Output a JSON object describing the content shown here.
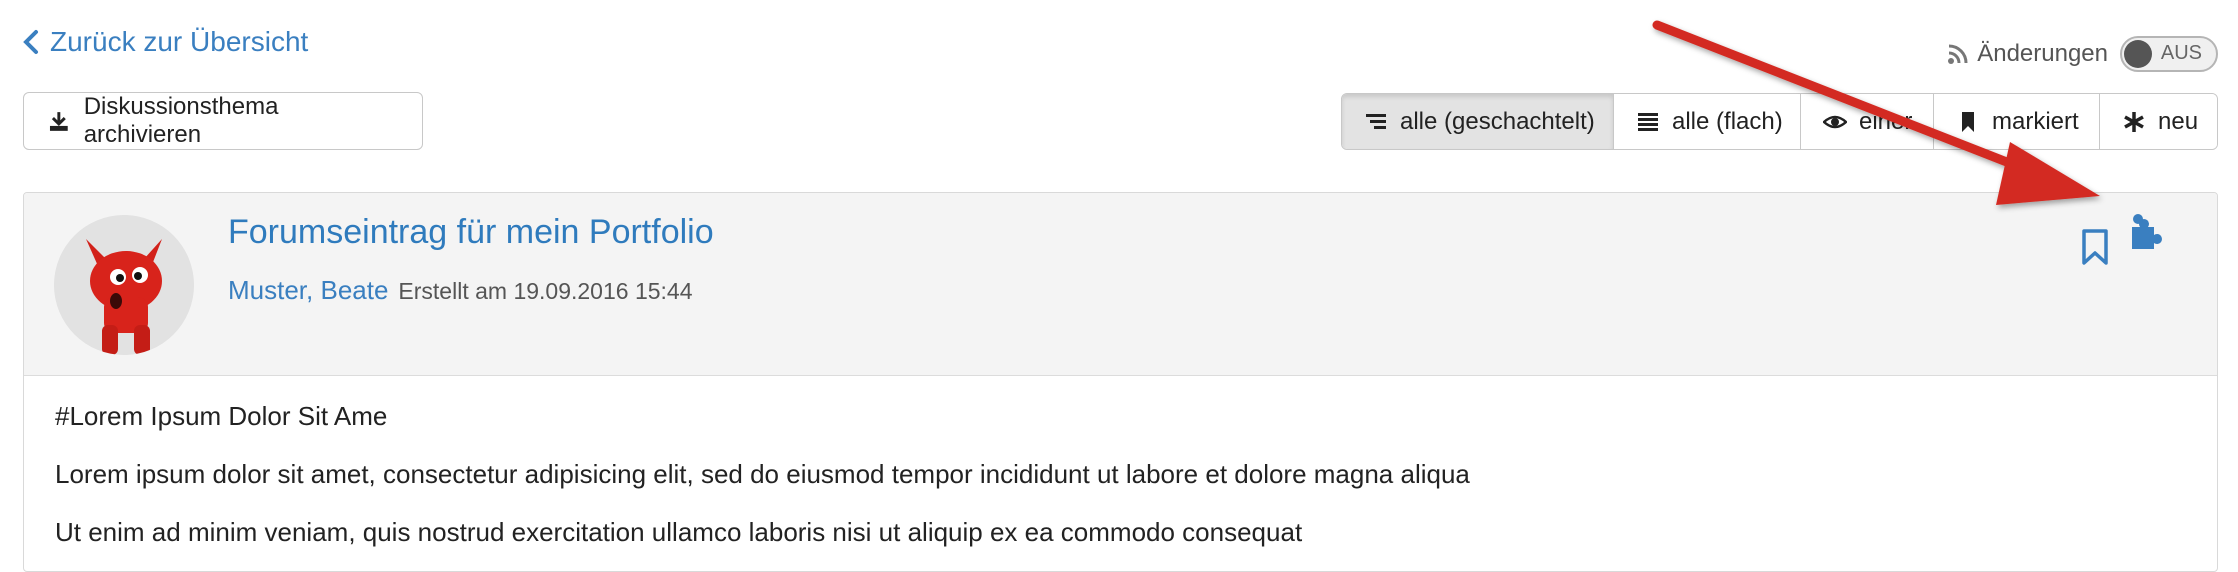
{
  "nav": {
    "back_label": "Zurück zur Übersicht"
  },
  "changes": {
    "label": "Änderungen",
    "toggle_state": "AUS"
  },
  "toolbar": {
    "archive_label": "Diskussionsthema archivieren",
    "view_options": [
      {
        "label": "alle (geschachtelt)",
        "icon": "indent-list-icon",
        "active": true
      },
      {
        "label": "alle (flach)",
        "icon": "list-icon",
        "active": false
      },
      {
        "label": "einer",
        "icon": "eye-icon",
        "active": false
      },
      {
        "label": "markiert",
        "icon": "bookmark-filled-icon",
        "active": false
      },
      {
        "label": "neu",
        "icon": "asterisk-icon",
        "active": false
      }
    ]
  },
  "post": {
    "title": "Forumseintrag für mein Portfolio",
    "author": "Muster, Beate",
    "created": "Erstellt am 19.09.2016 15:44",
    "body": [
      "#Lorem Ipsum Dolor Sit Ame",
      "Lorem ipsum dolor sit amet, consectetur adipisicing elit, sed do eiusmod tempor incididunt ut labore et dolore magna aliqua",
      "Ut enim ad minim veniam, quis nostrud exercitation ullamco laboris nisi ut aliquip ex ea commodo consequat"
    ]
  },
  "colors": {
    "link": "#3a7fc0",
    "annotation_arrow": "#d32b22",
    "header_bg": "#f4f4f4"
  }
}
